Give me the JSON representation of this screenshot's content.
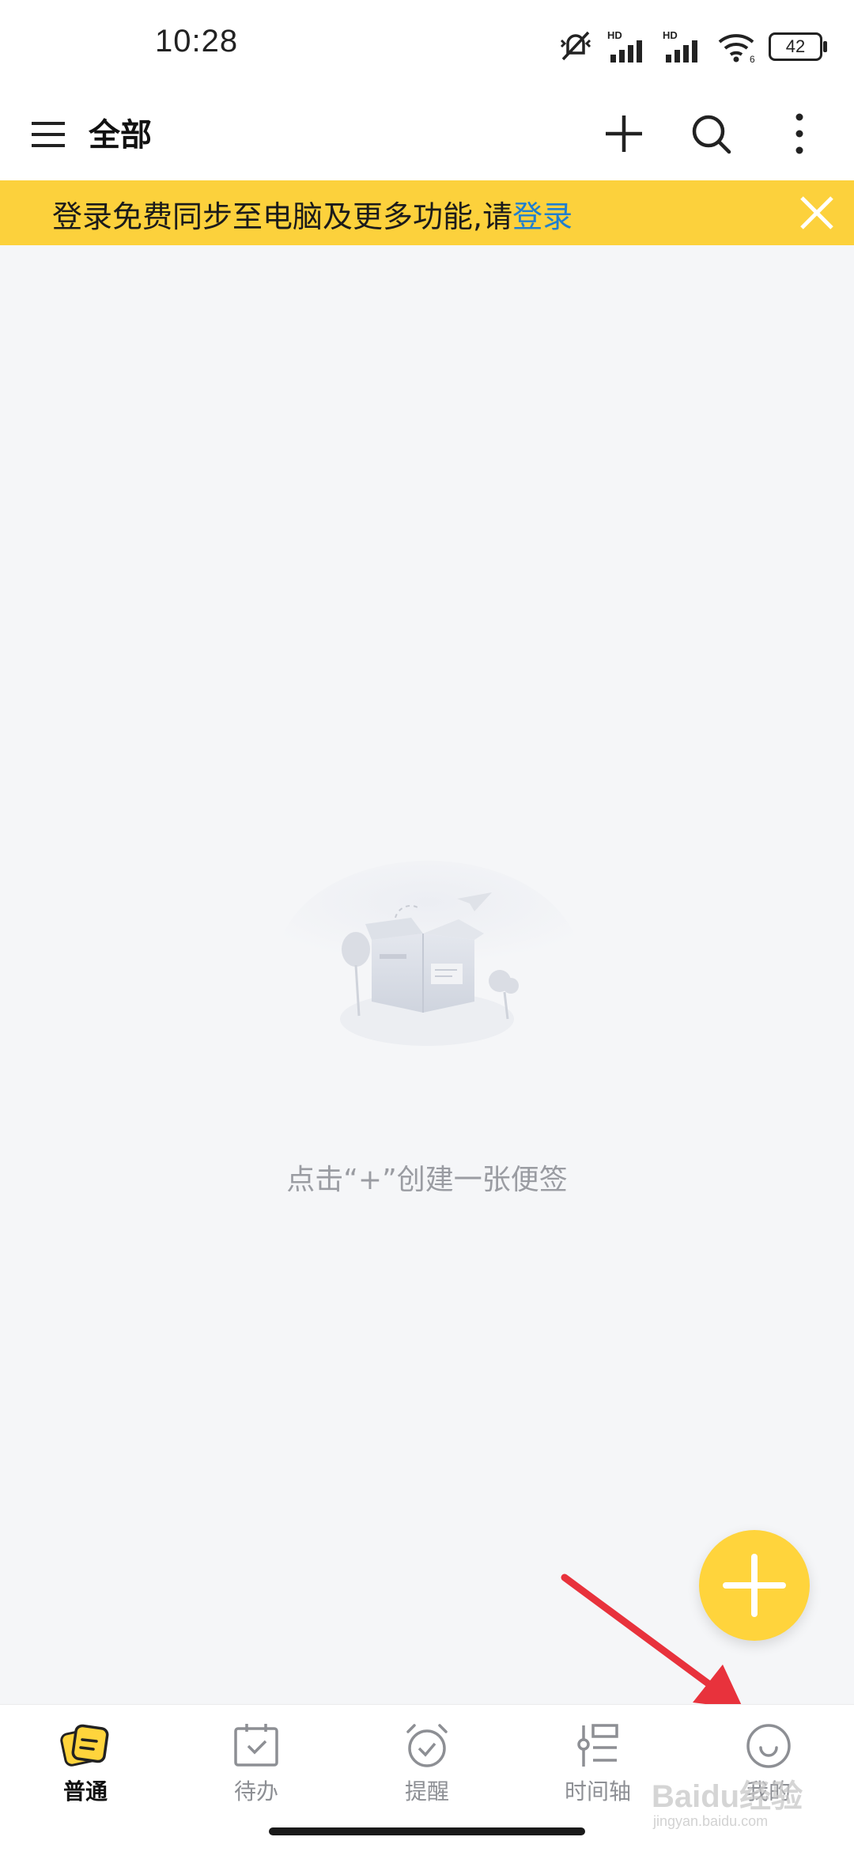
{
  "status_bar": {
    "time": "10:28",
    "battery": "42",
    "network_label": "HD"
  },
  "header": {
    "title": "全部"
  },
  "banner": {
    "text": "登录免费同步至电脑及更多功能,请",
    "link": "登录"
  },
  "empty_state": {
    "message": "点击“+”创建一张便签"
  },
  "bottom_nav": {
    "items": [
      {
        "label": "普通",
        "active": true
      },
      {
        "label": "待办",
        "active": false
      },
      {
        "label": "提醒",
        "active": false
      },
      {
        "label": "时间轴",
        "active": false
      },
      {
        "label": "我的",
        "active": false
      }
    ]
  },
  "watermark": {
    "brand": "Baidu经验",
    "url": "jingyan.baidu.com"
  },
  "colors": {
    "accent_yellow": "#ffd43c",
    "banner_yellow": "#fcd13c",
    "link_blue": "#1f7fcf",
    "arrow_red": "#e8323c"
  }
}
